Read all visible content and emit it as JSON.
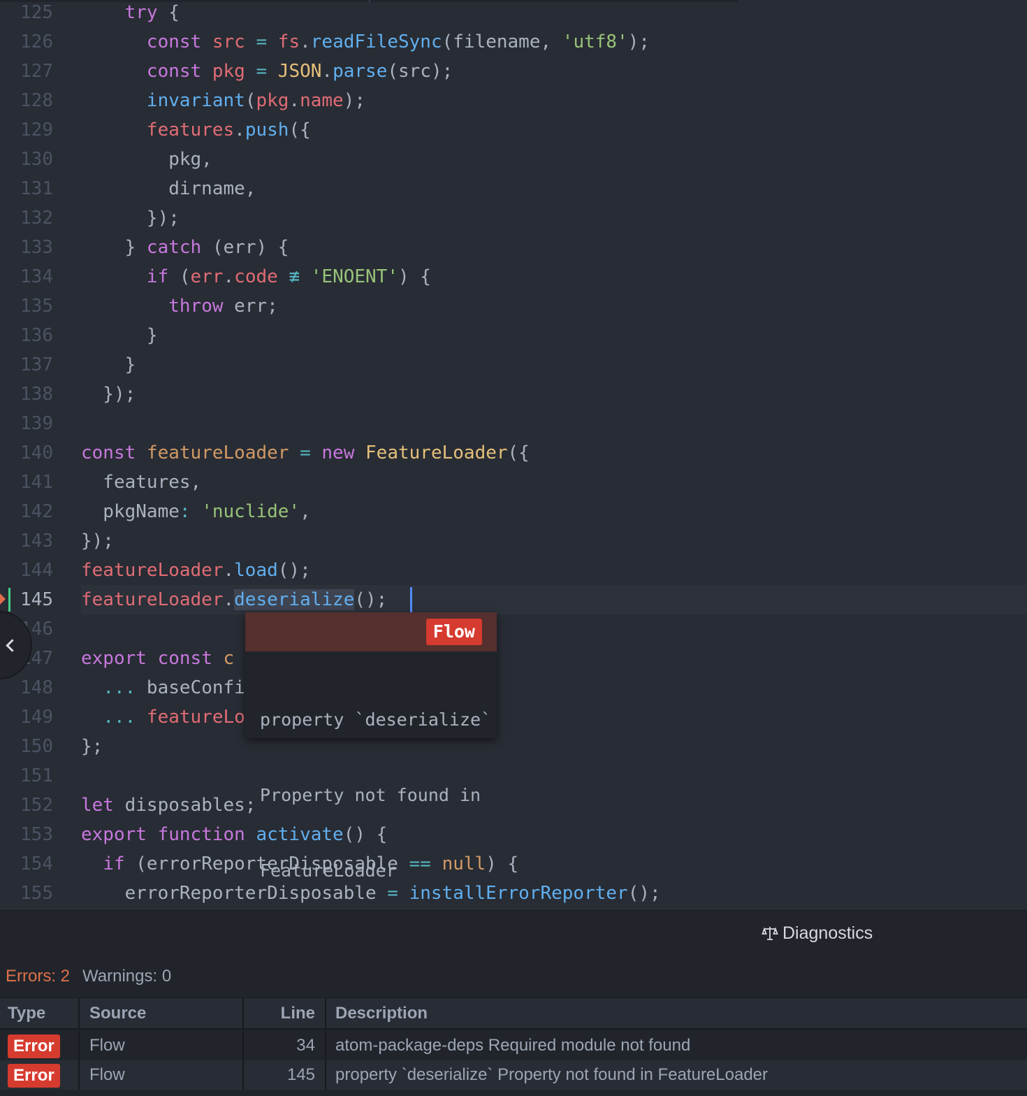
{
  "editor": {
    "code_lines": [
      {
        "num": "125",
        "tokens": [
          [
            "    ",
            "p"
          ],
          [
            "try",
            "k"
          ],
          [
            " {",
            "p"
          ]
        ]
      },
      {
        "num": "126",
        "tokens": [
          [
            "      ",
            "p"
          ],
          [
            "const",
            "k"
          ],
          [
            " ",
            "p"
          ],
          [
            "src",
            "v"
          ],
          [
            " ",
            "p"
          ],
          [
            "=",
            "o"
          ],
          [
            " ",
            "p"
          ],
          [
            "fs",
            "v"
          ],
          [
            ".",
            "p"
          ],
          [
            "readFileSync",
            "f"
          ],
          [
            "(filename, ",
            "p"
          ],
          [
            "'utf8'",
            "s"
          ],
          [
            ");",
            "p"
          ]
        ]
      },
      {
        "num": "127",
        "tokens": [
          [
            "      ",
            "p"
          ],
          [
            "const",
            "k"
          ],
          [
            " ",
            "p"
          ],
          [
            "pkg",
            "v"
          ],
          [
            " ",
            "p"
          ],
          [
            "=",
            "o"
          ],
          [
            " ",
            "p"
          ],
          [
            "JSON",
            "c"
          ],
          [
            ".",
            "p"
          ],
          [
            "parse",
            "f"
          ],
          [
            "(src);",
            "p"
          ]
        ]
      },
      {
        "num": "128",
        "tokens": [
          [
            "      ",
            "p"
          ],
          [
            "invariant",
            "f"
          ],
          [
            "(",
            "p"
          ],
          [
            "pkg",
            "v"
          ],
          [
            ".",
            "p"
          ],
          [
            "name",
            "v"
          ],
          [
            ");",
            "p"
          ]
        ]
      },
      {
        "num": "129",
        "tokens": [
          [
            "      ",
            "p"
          ],
          [
            "features",
            "v"
          ],
          [
            ".",
            "p"
          ],
          [
            "push",
            "f"
          ],
          [
            "({",
            "p"
          ]
        ]
      },
      {
        "num": "130",
        "tokens": [
          [
            "        pkg,",
            "p"
          ]
        ]
      },
      {
        "num": "131",
        "tokens": [
          [
            "        dirname,",
            "p"
          ]
        ]
      },
      {
        "num": "132",
        "tokens": [
          [
            "      });",
            "p"
          ]
        ]
      },
      {
        "num": "133",
        "tokens": [
          [
            "    } ",
            "p"
          ],
          [
            "catch",
            "k"
          ],
          [
            " (err) {",
            "p"
          ]
        ]
      },
      {
        "num": "134",
        "tokens": [
          [
            "      ",
            "p"
          ],
          [
            "if",
            "k"
          ],
          [
            " (",
            "p"
          ],
          [
            "err",
            "v"
          ],
          [
            ".",
            "p"
          ],
          [
            "code",
            "v"
          ],
          [
            " ",
            "p"
          ],
          [
            "≢",
            "o"
          ],
          [
            " ",
            "p"
          ],
          [
            "'ENOENT'",
            "s"
          ],
          [
            ") {",
            "p"
          ]
        ]
      },
      {
        "num": "135",
        "tokens": [
          [
            "        ",
            "p"
          ],
          [
            "throw",
            "k"
          ],
          [
            " err;",
            "p"
          ]
        ]
      },
      {
        "num": "136",
        "tokens": [
          [
            "      }",
            "p"
          ]
        ]
      },
      {
        "num": "137",
        "tokens": [
          [
            "    }",
            "p"
          ]
        ]
      },
      {
        "num": "138",
        "tokens": [
          [
            "  });",
            "p"
          ]
        ]
      },
      {
        "num": "139",
        "tokens": []
      },
      {
        "num": "140",
        "tokens": [
          [
            "const",
            "k"
          ],
          [
            " ",
            "p"
          ],
          [
            "featureLoader",
            "n"
          ],
          [
            " ",
            "p"
          ],
          [
            "=",
            "o"
          ],
          [
            " ",
            "p"
          ],
          [
            "new",
            "k"
          ],
          [
            " ",
            "p"
          ],
          [
            "FeatureLoader",
            "c"
          ],
          [
            "({",
            "p"
          ]
        ]
      },
      {
        "num": "141",
        "tokens": [
          [
            "  features,",
            "p"
          ]
        ]
      },
      {
        "num": "142",
        "tokens": [
          [
            "  pkgName",
            "p"
          ],
          [
            ":",
            "o"
          ],
          [
            " ",
            "p"
          ],
          [
            "'nuclide'",
            "s"
          ],
          [
            ",",
            "p"
          ]
        ]
      },
      {
        "num": "143",
        "tokens": [
          [
            "});",
            "p"
          ]
        ]
      },
      {
        "num": "144",
        "tokens": [
          [
            "featureLoader",
            "v"
          ],
          [
            ".",
            "p"
          ],
          [
            "load",
            "f"
          ],
          [
            "();",
            "p"
          ]
        ]
      },
      {
        "num": "145",
        "tokens": [
          [
            "featureLoader",
            "v"
          ],
          [
            ".",
            "p"
          ],
          [
            "deserialize",
            "sel"
          ],
          [
            "();",
            "p"
          ]
        ]
      },
      {
        "num": "146",
        "tokens": []
      },
      {
        "num": "147",
        "tokens": [
          [
            "export",
            "k"
          ],
          [
            " ",
            "p"
          ],
          [
            "const",
            "k"
          ],
          [
            " c",
            "n"
          ]
        ]
      },
      {
        "num": "148",
        "tokens": [
          [
            "  ",
            "p"
          ],
          [
            "...",
            "o"
          ],
          [
            " baseConfi",
            "p"
          ]
        ]
      },
      {
        "num": "149",
        "tokens": [
          [
            "  ",
            "p"
          ],
          [
            "...",
            "o"
          ],
          [
            " ",
            "p"
          ],
          [
            "featureLo",
            "v"
          ]
        ]
      },
      {
        "num": "150",
        "tokens": [
          [
            "};",
            "p"
          ]
        ]
      },
      {
        "num": "151",
        "tokens": []
      },
      {
        "num": "152",
        "tokens": [
          [
            "let",
            "k"
          ],
          [
            " disposables;",
            "p"
          ]
        ]
      },
      {
        "num": "153",
        "tokens": [
          [
            "export",
            "k"
          ],
          [
            " ",
            "p"
          ],
          [
            "function",
            "k"
          ],
          [
            " ",
            "p"
          ],
          [
            "activate",
            "f"
          ],
          [
            "() {",
            "p"
          ]
        ]
      },
      {
        "num": "154",
        "tokens": [
          [
            "  ",
            "p"
          ],
          [
            "if",
            "k"
          ],
          [
            " (errorReporterDisposable ",
            "p"
          ],
          [
            "==",
            "o"
          ],
          [
            " ",
            "p"
          ],
          [
            "null",
            "n"
          ],
          [
            ") {",
            "p"
          ]
        ]
      },
      {
        "num": "155",
        "tokens": [
          [
            "    errorReporterDisposable ",
            "p"
          ],
          [
            "=",
            "o"
          ],
          [
            " ",
            "p"
          ],
          [
            "installErrorReporter",
            "f"
          ],
          [
            "();",
            "p"
          ]
        ]
      }
    ],
    "active_line": "145",
    "tooltip": {
      "badge": "Flow",
      "message_lines": [
        "property `deserialize`",
        "Property not found in",
        "FeatureLoader"
      ]
    }
  },
  "diagnostics": {
    "title": "Diagnostics",
    "title_icon": "scale-icon",
    "errors_label": "Errors: 2",
    "warnings_label": "Warnings: 0",
    "columns": {
      "type": "Type",
      "source": "Source",
      "line": "Line",
      "description": "Description"
    },
    "rows": [
      {
        "type": "Error",
        "source": "Flow",
        "line": "34",
        "description": "atom-package-deps Required module not found"
      },
      {
        "type": "Error",
        "source": "Flow",
        "line": "145",
        "description": "property `deserialize` Property not found in FeatureLoader"
      }
    ]
  },
  "colors": {
    "editor_bg": "#282c34",
    "panel_bg": "#21252b",
    "error_badge": "#d63b2f",
    "error_text": "#e0704a",
    "keyword": "#c678dd",
    "string": "#98c379",
    "function": "#61afef",
    "variable": "#e06c75"
  }
}
